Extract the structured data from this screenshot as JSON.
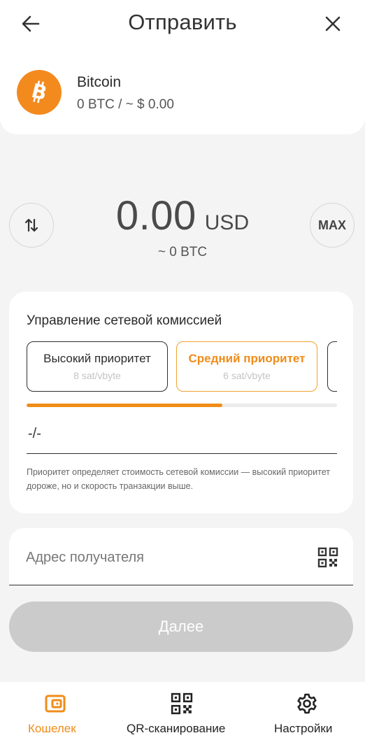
{
  "header": {
    "title": "Отправить",
    "back_icon": "arrow-left-icon",
    "close_icon": "close-icon"
  },
  "asset": {
    "name": "Bitcoin",
    "balance": "0 BTC / ~ $ 0.00",
    "icon": "bitcoin-icon",
    "icon_color": "#f38a1e"
  },
  "amount": {
    "value": "0.00",
    "currency": "USD",
    "secondary": "~ 0 BTC",
    "swap_icon": "swap-vertical-icon",
    "max_label": "MAX"
  },
  "fee": {
    "title": "Управление сетевой комиссией",
    "options": [
      {
        "label": "Высокий приоритет",
        "rate": "8 sat/vbyte",
        "selected": false
      },
      {
        "label": "Средний приоритет",
        "rate": "6 sat/vbyte",
        "selected": true
      }
    ],
    "progress_fraction": 0.63,
    "custom_value": "-/-",
    "hint": "Приоритет определяет стоимость сетевой комиссии — высокий приоритет дороже, но и скорость транзакции выше."
  },
  "recipient": {
    "placeholder": "Адрес получателя",
    "qr_icon": "qr-code-icon"
  },
  "next_button": {
    "label": "Далее",
    "disabled": true
  },
  "nav": {
    "items": [
      {
        "label": "Кошелек",
        "icon": "wallet-icon",
        "active": true
      },
      {
        "label": "QR-сканирование",
        "icon": "qr-code-icon",
        "active": false
      },
      {
        "label": "Настройки",
        "icon": "gear-icon",
        "active": false
      }
    ]
  },
  "colors": {
    "accent": "#f08c18",
    "background": "#f4f4f4",
    "disabled_button": "#cbcbcb"
  }
}
